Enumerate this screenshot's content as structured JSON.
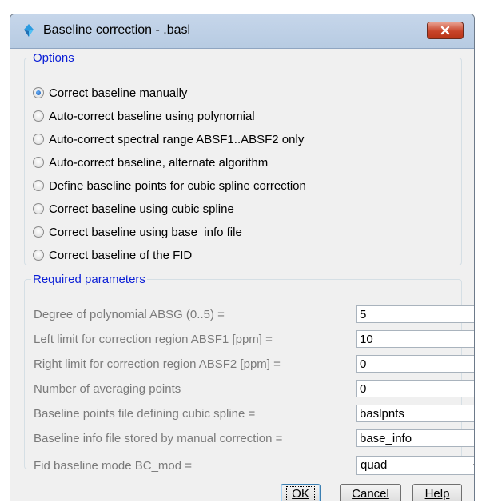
{
  "window": {
    "title": "Baseline correction - .basl"
  },
  "options": {
    "legend": "Options",
    "items": [
      {
        "label": "Correct baseline manually",
        "checked": true
      },
      {
        "label": "Auto-correct baseline using polynomial",
        "checked": false
      },
      {
        "label": "Auto-correct spectral range ABSF1..ABSF2 only",
        "checked": false
      },
      {
        "label": "Auto-correct baseline, alternate algorithm",
        "checked": false
      },
      {
        "label": "Define baseline points for cubic spline correction",
        "checked": false
      },
      {
        "label": "Correct baseline using cubic spline",
        "checked": false
      },
      {
        "label": "Correct baseline using base_info file",
        "checked": false
      },
      {
        "label": "Correct baseline of the FID",
        "checked": false
      }
    ]
  },
  "params": {
    "legend": "Required parameters",
    "rows": [
      {
        "label": "Degree of polynomial ABSG (0..5) =",
        "value": "5"
      },
      {
        "label": "Left limit for correction region ABSF1 [ppm] =",
        "value": "10"
      },
      {
        "label": "Right limit for correction region ABSF2 [ppm] =",
        "value": "0"
      },
      {
        "label": "Number of averaging points",
        "value": "0"
      },
      {
        "label": "Baseline points file defining cubic spline =",
        "value": "baslpnts"
      },
      {
        "label": "Baseline info file stored by manual correction =",
        "value": "base_info"
      }
    ],
    "mode": {
      "label": "Fid baseline mode BC_mod =",
      "selected": "quad"
    }
  },
  "buttons": {
    "ok": "OK",
    "cancel": "Cancel",
    "help": "Help"
  },
  "colors": {
    "legend": "#0a1ed6",
    "disabled_text": "#7a7a7a",
    "close_button": "#c8452a"
  }
}
